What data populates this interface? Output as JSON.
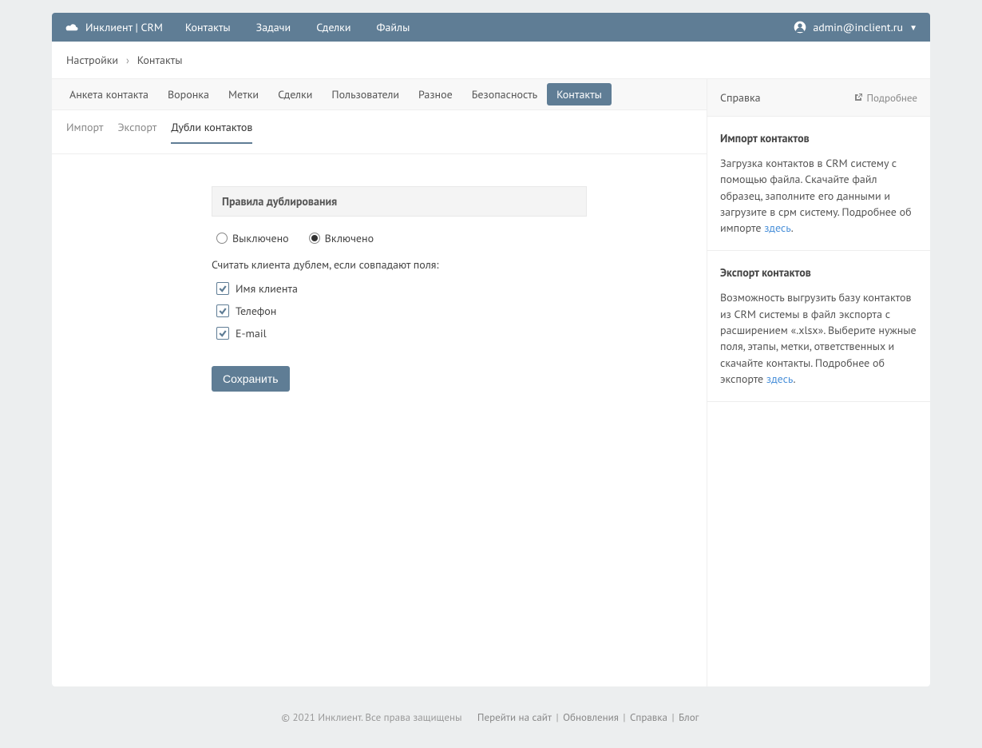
{
  "brand": "Инклиент | CRM",
  "nav": {
    "contacts": "Контакты",
    "tasks": "Задачи",
    "deals": "Сделки",
    "files": "Файлы"
  },
  "user": {
    "email": "admin@inclient.ru"
  },
  "breadcrumb": {
    "parent": "Настройки",
    "current": "Контакты"
  },
  "tabs": {
    "profile": "Анкета контакта",
    "funnel": "Воронка",
    "labels": "Метки",
    "deals": "Сделки",
    "users": "Пользователи",
    "misc": "Разное",
    "security": "Безопасность",
    "contacts": "Контакты"
  },
  "subtabs": {
    "import": "Импорт",
    "export": "Экспорт",
    "dup": "Дубли контактов"
  },
  "form": {
    "section": "Правила дублирования",
    "radio_off": "Выключено",
    "radio_on": "Включено",
    "desc": "Считать клиента дублем, если совпадают поля:",
    "chk_name": "Имя клиента",
    "chk_phone": "Телефон",
    "chk_email": "E-mail",
    "save": "Сохранить"
  },
  "side": {
    "help": "Справка",
    "more": "Подробнее",
    "importTitle": "Импорт контактов",
    "importBody": "Загрузка контактов в CRM систему с помощью файла. Скачайте файл образец, заполните его данными и загрузите в срм систему. Подробнее об импорте ",
    "exportTitle": "Экспорт контактов",
    "exportBody": "Возможность выгрузить базу контактов из CRM системы в файл экспорта с расширением «.xlsx». Выберите нужные поля, этапы, метки, ответственных и скачайте контакты. Подробнее об экспорте ",
    "here": "здесь"
  },
  "footer": {
    "copy": "© 2021 Инклиент. Все права защищены",
    "site": "Перейти на сайт",
    "updates": "Обновления",
    "help": "Справка",
    "blog": "Блог"
  }
}
